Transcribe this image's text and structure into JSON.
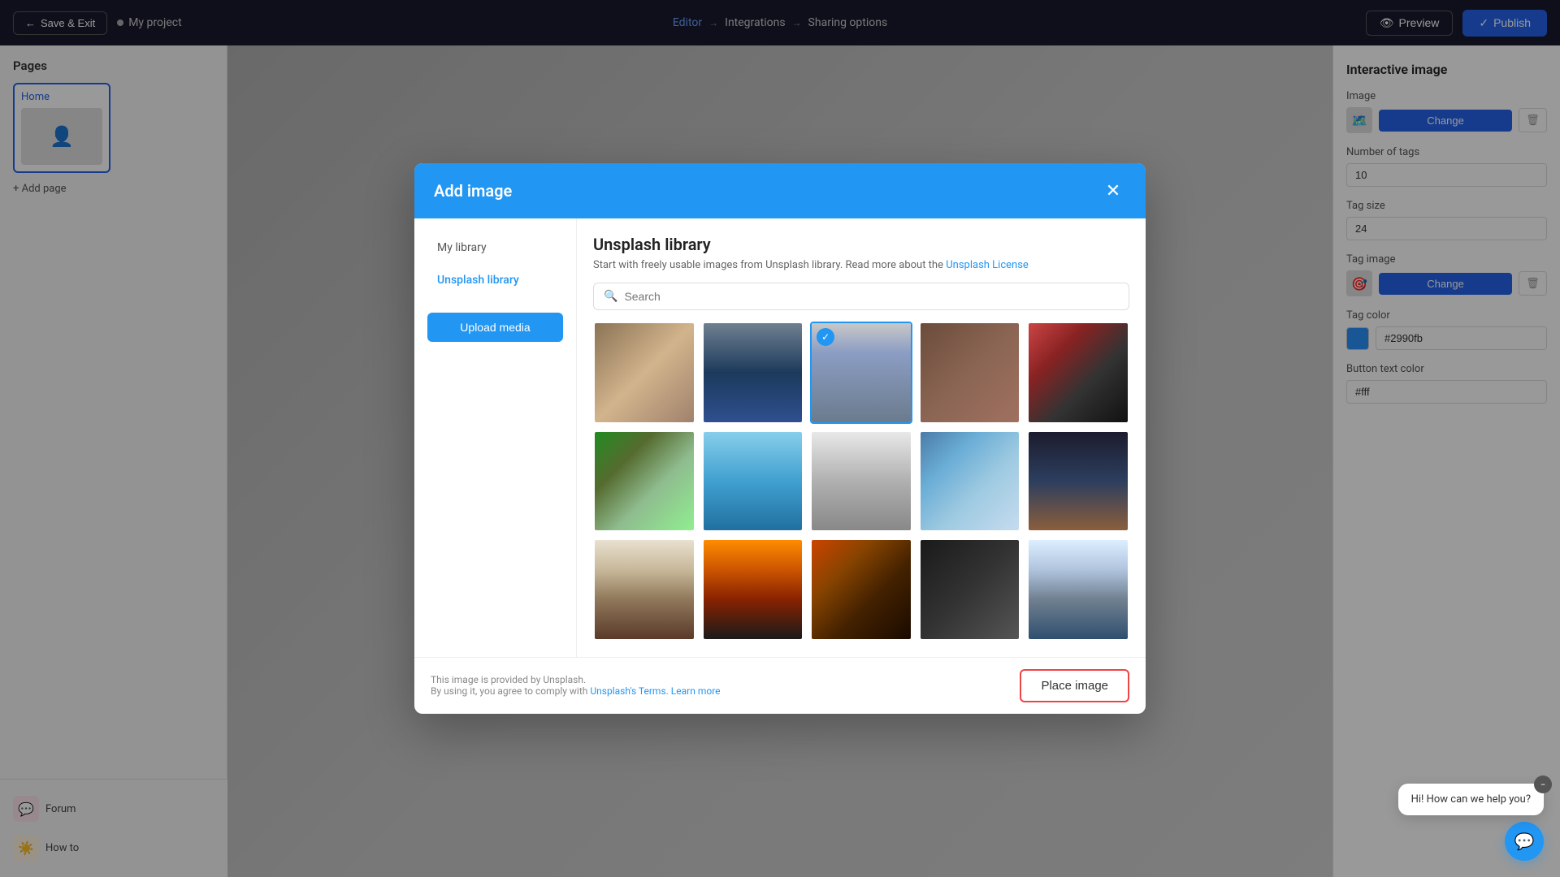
{
  "topnav": {
    "save_exit_label": "Save & Exit",
    "project_name": "My project",
    "editor_label": "Editor",
    "integrations_label": "Integrations",
    "sharing_options_label": "Sharing options",
    "preview_label": "Preview",
    "publish_label": "Publish"
  },
  "left_sidebar": {
    "pages_title": "Pages",
    "page_label": "Home",
    "add_page_label": "+ Add page"
  },
  "right_sidebar": {
    "panel_title": "Interactive image",
    "image_label": "Image",
    "change_label": "Change",
    "number_of_tags_label": "Number of tags",
    "number_of_tags_value": "10",
    "tag_size_label": "Tag size",
    "tag_size_value": "24",
    "tag_image_label": "Tag image",
    "change_tag_label": "Change",
    "tag_color_label": "Tag color",
    "tag_color_value": "#2990fb",
    "button_text_color_label": "Button text color",
    "button_text_color_value": "#fff"
  },
  "modal": {
    "title": "Add image",
    "close_label": "×",
    "nav_items": [
      {
        "id": "my-library",
        "label": "My library",
        "active": false
      },
      {
        "id": "unsplash-library",
        "label": "Unsplash library",
        "active": true
      }
    ],
    "upload_button_label": "Upload media",
    "content_title": "Unsplash library",
    "content_desc": "Start with freely usable images from Unsplash library. Read more about the",
    "unsplash_license_link": "Unsplash License",
    "search_placeholder": "Search",
    "footer_text_1": "This image is provided by Unsplash.",
    "footer_text_2": "By using it, you agree to comply with",
    "unsplash_terms_link": "Unsplash's Terms.",
    "learn_more_link": "Learn more",
    "place_image_label": "Place image",
    "images": [
      {
        "id": 1,
        "class": "img-1",
        "selected": false
      },
      {
        "id": 2,
        "class": "img-2",
        "selected": false
      },
      {
        "id": 3,
        "class": "img-3",
        "selected": true
      },
      {
        "id": 4,
        "class": "img-4",
        "selected": false
      },
      {
        "id": 5,
        "class": "img-5",
        "selected": false
      },
      {
        "id": 6,
        "class": "img-6",
        "selected": false
      },
      {
        "id": 7,
        "class": "img-7",
        "selected": false
      },
      {
        "id": 8,
        "class": "img-8",
        "selected": false
      },
      {
        "id": 9,
        "class": "img-9",
        "selected": false
      },
      {
        "id": 10,
        "class": "img-10",
        "selected": false
      },
      {
        "id": 11,
        "class": "img-11",
        "selected": false
      },
      {
        "id": 12,
        "class": "img-12",
        "selected": false
      },
      {
        "id": 13,
        "class": "img-13",
        "selected": false
      },
      {
        "id": 14,
        "class": "img-14",
        "selected": false
      },
      {
        "id": 15,
        "class": "img-15",
        "selected": false
      }
    ]
  },
  "bottom_nav": [
    {
      "id": "forum",
      "label": "Forum",
      "icon": "💬",
      "icon_class": "forum"
    },
    {
      "id": "howto",
      "label": "How to",
      "icon": "☀️",
      "icon_class": "howto"
    }
  ],
  "chat": {
    "message": "Hi! How can we help you?",
    "minimize_icon": "−",
    "button_icon": "💬"
  }
}
